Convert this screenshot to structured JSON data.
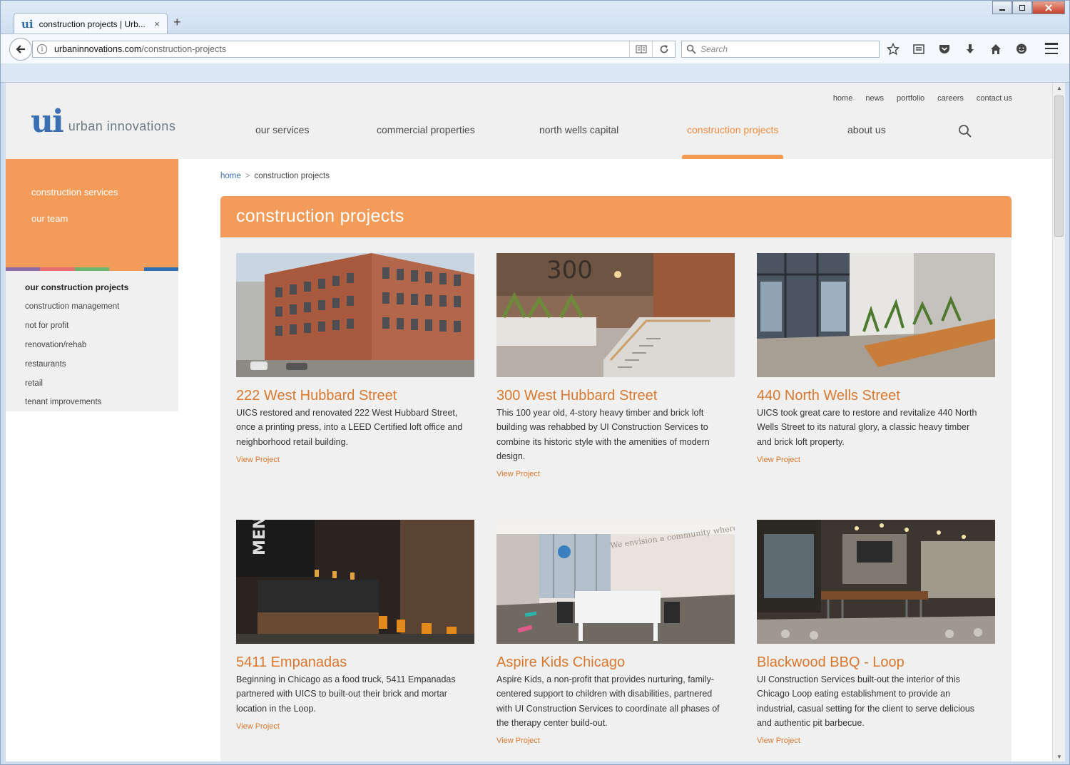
{
  "browser": {
    "tab_title": "construction projects | Urb...",
    "tab_favicon": "ui",
    "tab_close": "×",
    "new_tab": "+",
    "url_host": "urbaninnovations.com",
    "url_path": "/construction-projects",
    "search_placeholder": "Search",
    "window_controls": [
      "minimize",
      "restore",
      "close"
    ]
  },
  "site": {
    "logo_mark": "ui",
    "logo_text": "urban innovations",
    "utility_nav": [
      "home",
      "news",
      "portfolio",
      "careers",
      "contact us"
    ],
    "main_nav": [
      "our services",
      "commercial properties",
      "north wells capital",
      "construction projects",
      "about us"
    ],
    "active_nav": "construction projects",
    "accent_color": "#f39c5a",
    "link_color": "#d9782f"
  },
  "sidebar": {
    "top_links": [
      "construction services",
      "our team"
    ],
    "strip_colors": [
      "#8e6aa8",
      "#e46f6f",
      "#6cb56b",
      "#f39c5a",
      "#2f6eb5"
    ],
    "heading": "our construction projects",
    "items": [
      "construction management",
      "not for profit",
      "renovation/rehab",
      "restaurants",
      "retail",
      "tenant improvements"
    ]
  },
  "breadcrumb": {
    "home": "home",
    "separator": ">",
    "current": "construction projects"
  },
  "page": {
    "title": "construction projects"
  },
  "projects": [
    {
      "title": "222 West Hubbard Street",
      "description": "UICS restored and renovated 222 West Hubbard Street, once a printing press, into a LEED Certified loft office and neighborhood retail building.",
      "link": "View Project"
    },
    {
      "title": "300 West Hubbard Street",
      "description": "This 100 year old, 4-story heavy timber and brick loft building was rehabbed by UI Construction Services to combine its historic style with the amenities of modern design.",
      "link": "View Project"
    },
    {
      "title": "440 North Wells Street",
      "description": "UICS took great care to restore and revitalize 440 North Wells Street to its natural glory, a classic heavy timber and brick loft property.",
      "link": "View Project"
    },
    {
      "title": "5411 Empanadas",
      "description": "Beginning in Chicago as a food truck, 5411 Empanadas partnered with UICS to built-out their brick and mortar location in the Loop.",
      "link": "View Project"
    },
    {
      "title": "Aspire Kids Chicago",
      "description": "Aspire Kids, a non-profit that provides nurturing, family-centered support to children with disabilities, partnered with UI Construction Services to coordinate all phases of the therapy center build-out.",
      "link": "View Project"
    },
    {
      "title": "Blackwood BBQ - Loop",
      "description": "UI Construction Services built-out the interior of this Chicago Loop eating establishment to provide an industrial, casual setting for the client to serve delicious and authentic pit barbecue.",
      "link": "View Project"
    }
  ],
  "photo_text": {
    "lobby_number": "300",
    "menu_sign": "MENU",
    "aspire_wall": "We envision a community where people of all abilities live, learn and grow together."
  }
}
